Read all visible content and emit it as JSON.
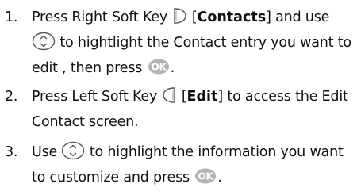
{
  "steps": [
    {
      "number": "1.",
      "line1": {
        "pre": "Press Right Soft Key",
        "bracket_open": "[",
        "keyword": "Contacts",
        "bracket_close": "]",
        "post": "and use"
      },
      "line2": {
        "post": "to hightlight the Contact entry you want to"
      },
      "line3": {
        "pre": "edit , then press",
        "end": "."
      }
    },
    {
      "number": "2.",
      "line1": {
        "pre": "Press Left Soft Key",
        "bracket_open": "[",
        "keyword": "Edit",
        "bracket_close": "]",
        "post": "to access the Edit"
      },
      "line2": {
        "text": "Contact screen."
      }
    },
    {
      "number": "3.",
      "line1": {
        "pre": "Use",
        "post": "to highlight the information you want"
      },
      "line2": {
        "pre": "to customize and press",
        "end": "."
      }
    }
  ],
  "icons": {
    "ok_label": "OK",
    "icon_color": "#b3b3b3",
    "icon_stroke": "#555555"
  }
}
